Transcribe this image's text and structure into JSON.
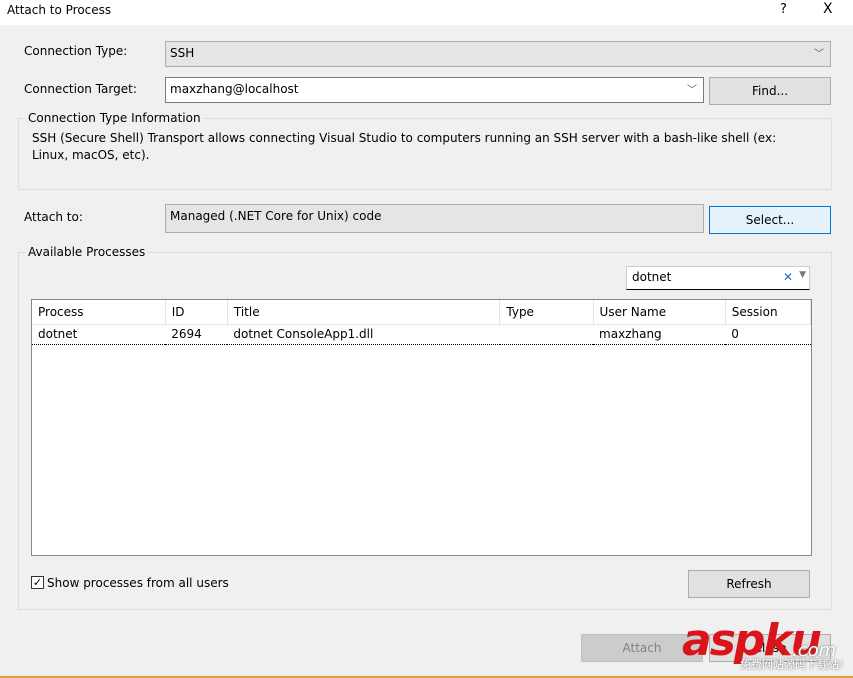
{
  "window": {
    "title": "Attach to Process",
    "help": "?",
    "close": "X"
  },
  "connection_type": {
    "label": "Connection Type:",
    "value": "SSH"
  },
  "connection_target": {
    "label": "Connection Target:",
    "value": "maxzhang@localhost",
    "find": "Find..."
  },
  "info": {
    "heading": "Connection Type Information",
    "text": "SSH (Secure Shell) Transport allows connecting Visual Studio to computers running an SSH server with a bash-like shell (ex: Linux, macOS, etc)."
  },
  "attach_to": {
    "label": "Attach to:",
    "value": "Managed (.NET Core for Unix) code",
    "select": "Select..."
  },
  "processes": {
    "heading": "Available Processes",
    "filter": "dotnet",
    "columns": [
      "Process",
      "ID",
      "Title",
      "Type",
      "User Name",
      "Session"
    ],
    "rows": [
      [
        "dotnet",
        "2694",
        "dotnet ConsoleApp1.dll",
        "",
        "maxzhang",
        "0"
      ]
    ],
    "show_all_label": "Show processes from all users",
    "show_all_checked": true,
    "refresh": "Refresh"
  },
  "footer": {
    "attach": "Attach",
    "close": "Close"
  },
  "watermark": {
    "logo": "aspku",
    "suffix": ".com",
    "tagline": "免费网站源码下载站!"
  }
}
